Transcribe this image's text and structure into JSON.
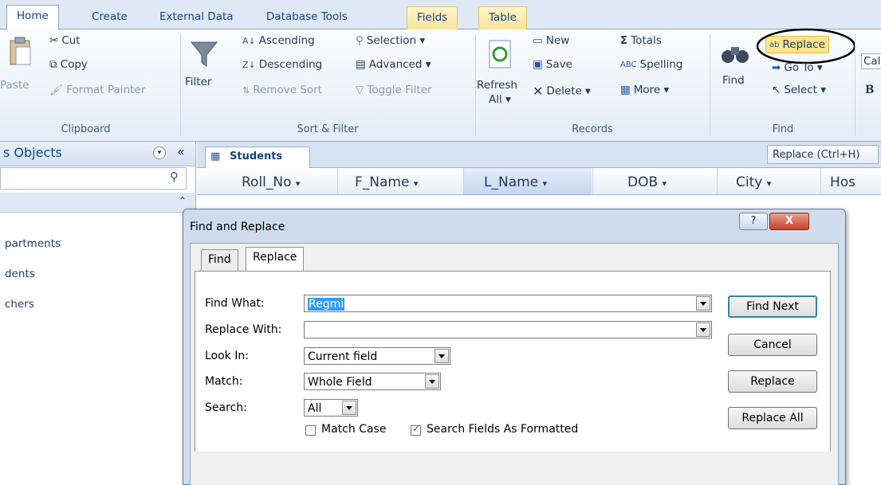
{
  "ribbon_tabs": [
    "Home",
    "Create",
    "External Data",
    "Database Tools",
    "Fields",
    "Table"
  ],
  "clipboard": {
    "paste": "Paste",
    "cut": "Cut",
    "copy": "Copy",
    "format_painter": "Format Painter",
    "group": "Clipboard"
  },
  "sort_filter": {
    "filter": "Filter",
    "ascending": "Ascending",
    "descending": "Descending",
    "remove_sort": "Remove Sort",
    "selection": "Selection",
    "advanced": "Advanced",
    "toggle_filter": "Toggle Filter",
    "group": "Sort & Filter"
  },
  "records": {
    "refresh": "Refresh",
    "refresh_all": "All",
    "new": "New",
    "save": "Save",
    "delete": "Delete",
    "totals": "Totals",
    "spelling": "Spelling",
    "more": "More",
    "group": "Records"
  },
  "find": {
    "find": "Find",
    "replace": "Replace",
    "goto": "Go To",
    "select": "Select",
    "group": "Find",
    "font_partial": "Cal",
    "bold": "B"
  },
  "nav": {
    "title": "s Objects",
    "section_collapse": "«",
    "items": [
      "partments",
      "dents",
      "chers"
    ]
  },
  "document": {
    "tab": "Students",
    "tooltip": "Replace (Ctrl+H)",
    "columns": [
      "Roll_No",
      "F_Name",
      "L_Name",
      "DOB",
      "City",
      "Hos"
    ]
  },
  "dialog": {
    "title": "Find and Replace",
    "tabs": [
      "Find",
      "Replace"
    ],
    "active_tab": "Replace",
    "find_what_label": "Find What:",
    "find_what_value": "Regmi",
    "replace_with_label": "Replace With:",
    "replace_with_value": "",
    "look_in_label": "Look In:",
    "look_in_value": "Current field",
    "match_label": "Match:",
    "match_value": "Whole Field",
    "search_label": "Search:",
    "search_value": "All",
    "match_case": "Match Case",
    "match_case_checked": false,
    "search_formatted": "Search Fields As Formatted",
    "search_formatted_checked": true,
    "buttons": {
      "find_next": "Find Next",
      "cancel": "Cancel",
      "replace": "Replace",
      "replace_all": "Replace All"
    },
    "help": "?",
    "close": "X"
  }
}
